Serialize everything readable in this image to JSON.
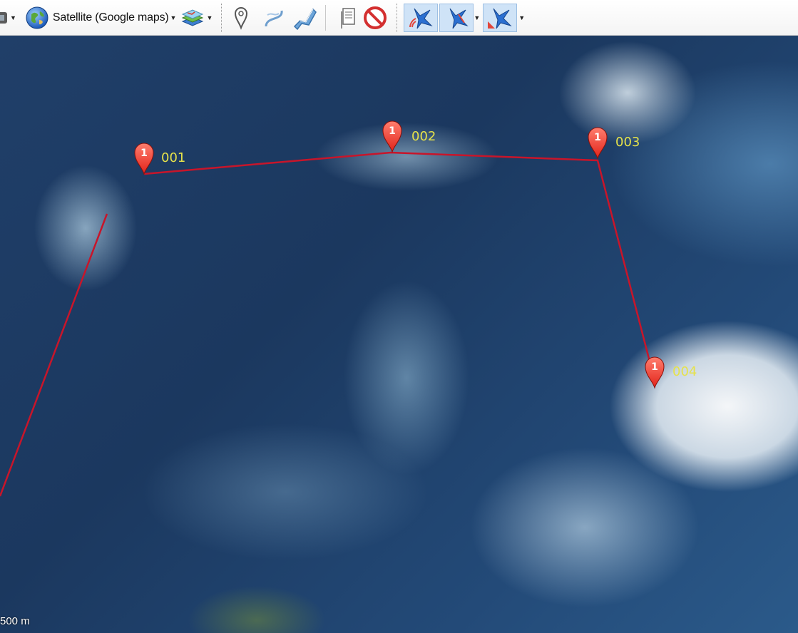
{
  "toolbar": {
    "map_type_label": "Satellite (Google maps)",
    "buttons": [
      {
        "name": "gps-device-icon"
      },
      {
        "name": "globe-icon"
      },
      {
        "name": "layers-icon"
      },
      {
        "name": "new-waypoint-icon"
      },
      {
        "name": "new-track-icon"
      },
      {
        "name": "new-route-icon"
      },
      {
        "name": "notes-icon"
      },
      {
        "name": "delete-icon"
      },
      {
        "name": "tracking-mode-1-icon"
      },
      {
        "name": "tracking-mode-2-icon"
      },
      {
        "name": "tracking-mode-3-icon"
      }
    ]
  },
  "map": {
    "route_color": "#c8152a",
    "waypoints": [
      {
        "label": "001",
        "badge": "1"
      },
      {
        "label": "002",
        "badge": "1"
      },
      {
        "label": "003",
        "badge": "1"
      },
      {
        "label": "004",
        "badge": "1"
      }
    ],
    "scale_text": "500 m"
  }
}
